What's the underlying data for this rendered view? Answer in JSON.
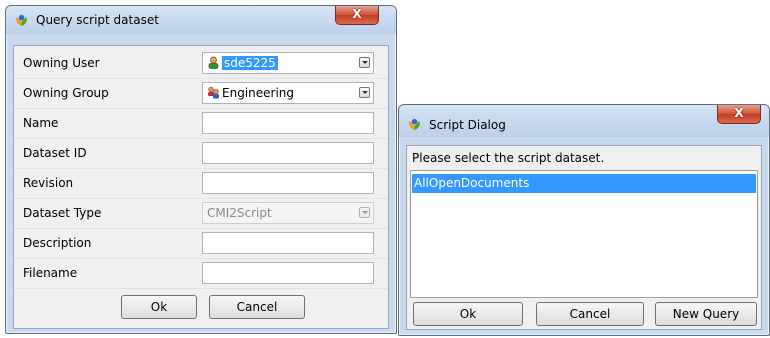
{
  "query_dialog": {
    "title": "Query script dataset",
    "close_label": "X",
    "fields": [
      {
        "label": "Owning User",
        "value": "sde5225"
      },
      {
        "label": "Owning Group",
        "value": "Engineering"
      },
      {
        "label": "Name",
        "value": ""
      },
      {
        "label": "Dataset ID",
        "value": ""
      },
      {
        "label": "Revision",
        "value": ""
      },
      {
        "label": "Dataset Type",
        "value": "CMI2Script"
      },
      {
        "label": "Description",
        "value": ""
      },
      {
        "label": "Filename",
        "value": ""
      }
    ],
    "ok_label": "Ok",
    "cancel_label": "Cancel"
  },
  "script_dialog": {
    "title": "Script Dialog",
    "close_label": "X",
    "prompt": "Please select the script dataset.",
    "items": [
      "AllOpenDocuments"
    ],
    "ok_label": "Ok",
    "cancel_label": "Cancel",
    "new_query_label": "New Query"
  },
  "icons": {
    "app": "teamcenter-icon",
    "user": "user-icon",
    "group": "group-icon"
  },
  "colors": {
    "selection": "#3399ff",
    "close_button": "#c9452c",
    "window_frame": "#c9d9ee"
  }
}
